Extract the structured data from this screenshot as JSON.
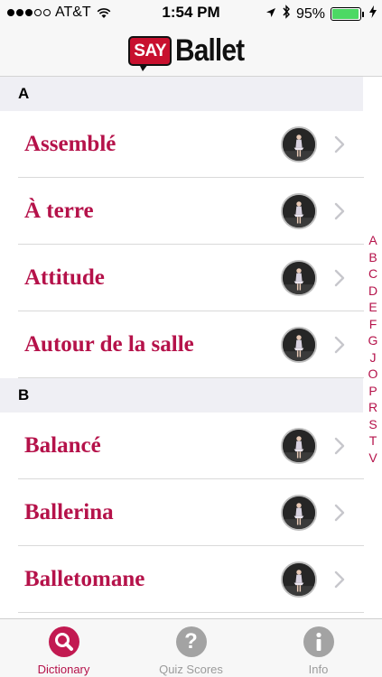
{
  "status_bar": {
    "carrier": "AT&T",
    "time": "1:54 PM",
    "battery_percent": "95%",
    "battery_level": 0.95,
    "signal_bars_filled": 3,
    "signal_bars_total": 5,
    "icons": [
      "wifi-icon",
      "location-icon",
      "bluetooth-icon",
      "battery-icon",
      "charging-icon"
    ]
  },
  "header": {
    "logo_badge": "SAY",
    "logo_text": "Ballet",
    "logo_color": "#c8102e"
  },
  "sections": [
    {
      "header": "A",
      "items": [
        {
          "label": "Assemblé"
        },
        {
          "label": "À terre"
        },
        {
          "label": "Attitude"
        },
        {
          "label": "Autour de la salle"
        }
      ]
    },
    {
      "header": "B",
      "items": [
        {
          "label": "Balancé"
        },
        {
          "label": "Ballerina"
        },
        {
          "label": "Balletomane"
        }
      ]
    }
  ],
  "index_letters": [
    "A",
    "B",
    "C",
    "D",
    "E",
    "F",
    "G",
    "J",
    "O",
    "P",
    "R",
    "S",
    "T",
    "V"
  ],
  "tabs": [
    {
      "label": "Dictionary",
      "icon": "search-icon",
      "active": true
    },
    {
      "label": "Quiz Scores",
      "icon": "question-icon",
      "active": false
    },
    {
      "label": "Info",
      "icon": "info-icon",
      "active": false
    }
  ],
  "colors": {
    "accent": "#b5124a",
    "section_bg": "#efeff4",
    "battery": "#4cd964"
  }
}
